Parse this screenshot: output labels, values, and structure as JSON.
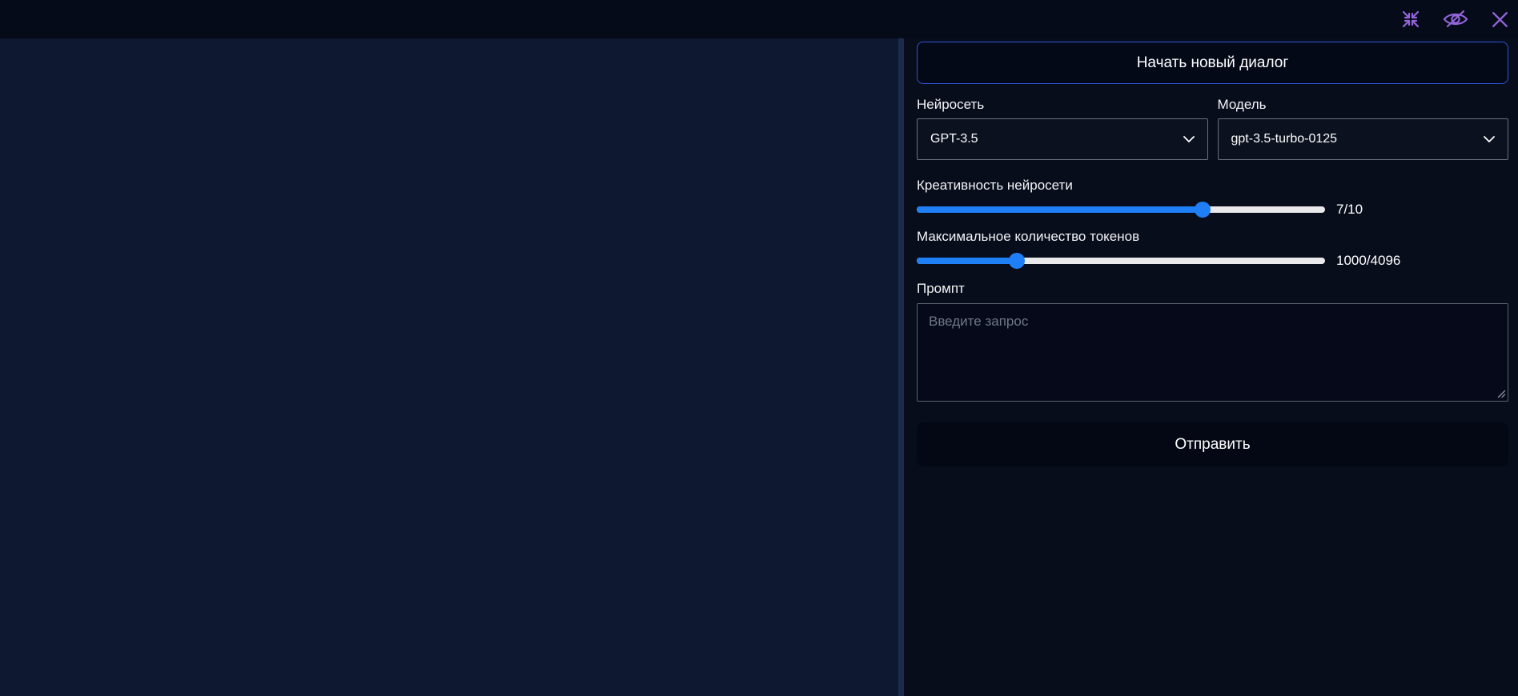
{
  "colors": {
    "topbar_bg": "#060b1a",
    "chat_area_bg": "#0e1831",
    "panel_bg": "#080d1b",
    "divider": "#1c2b4d",
    "accent_blue_border": "#3152d4",
    "slider_blue": "#1f7ff6",
    "slider_track": "#e9e9eb",
    "icon_purple": "#9265da",
    "input_border": "#6a7080",
    "placeholder_grey": "#707786"
  },
  "topbar": {
    "icons": [
      "collapse-icon",
      "eye-off-icon",
      "close-icon"
    ]
  },
  "panel": {
    "new_dialog_button": "Начать новый диалог",
    "network": {
      "label": "Нейросеть",
      "value": "GPT-3.5"
    },
    "model": {
      "label": "Модель",
      "value": "gpt-3.5-turbo-0125"
    },
    "sliders": [
      {
        "label": "Креативность нейросети",
        "value": 7,
        "max": 10,
        "display": "7/10"
      },
      {
        "label": "Максимальное количество токенов",
        "value": 1000,
        "max": 4096,
        "display": "1000/4096"
      }
    ],
    "prompt": {
      "label": "Промпт",
      "placeholder": "Введите запрос",
      "value": ""
    },
    "send_button": "Отправить"
  }
}
